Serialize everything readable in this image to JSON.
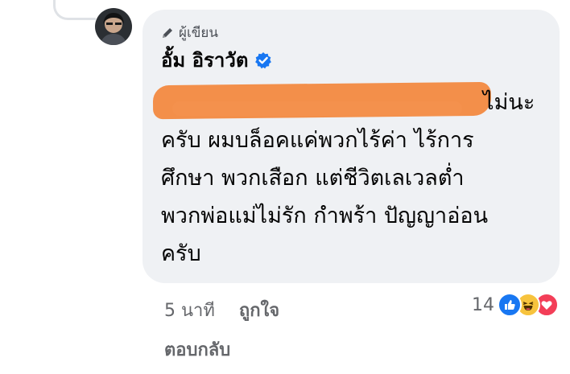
{
  "comment": {
    "author_badge": "ผู้เขียน",
    "author_name": "อั้ม อิราวัต",
    "verified": true,
    "text_lines": [
      "ไม่นะ",
      "ครับ ผมบล็อคแค่พวกไร้ค่า ไร้การ",
      "ศึกษา พวกเสือก แต่ชีวิตเลเวลต่ำ",
      "พวกพ่อแม่ไม่รัก กำพร้า ปัญญาอ่อน",
      "ครับ"
    ],
    "timestamp": "5 นาที",
    "like_label": "ถูกใจ",
    "reply_label": "ตอบกลับ",
    "reaction_count": "14",
    "reactions": [
      "like-icon",
      "haha-icon",
      "love-icon"
    ]
  },
  "colors": {
    "bubble": "#eff1f4",
    "redaction": "#f28a43",
    "verified": "#1877f2",
    "secondary_text": "#65676b"
  }
}
